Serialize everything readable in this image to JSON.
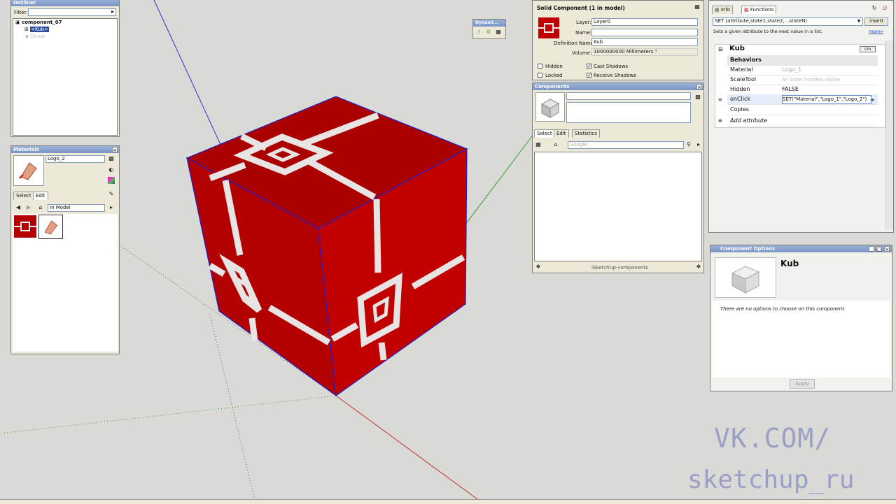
{
  "outliner": {
    "title": "Outliner",
    "filter_label": "Filter:",
    "tree": [
      "component_07",
      "<Kub>",
      "Group"
    ]
  },
  "materials": {
    "title": "Materials",
    "name_value": "Logo_2",
    "tabs": [
      "Select",
      "Edit"
    ],
    "collection": "In Model",
    "accent": "#b30000"
  },
  "dynamic_toolbar": {
    "title": "Dynami..."
  },
  "entity_info": {
    "title": "Solid Component (1 in model)",
    "layer_label": "Layer:",
    "layer_value": "Layer0",
    "name_label": "Name:",
    "name_value": "",
    "definition_label": "Definition Name:",
    "definition_value": "Kub",
    "volume_label": "Volume:",
    "volume_value": "1000000000 Millimeters ³",
    "hidden_label": "Hidden",
    "locked_label": "Locked",
    "cast_label": "Cast Shadows",
    "receive_label": "Receive Shadows"
  },
  "components": {
    "title": "Components",
    "tabs": [
      "Select",
      "Edit",
      "Statistics"
    ],
    "search_placeholder": "Google",
    "footer": "iSketchUp-components"
  },
  "attributes": {
    "tab_info": "Info",
    "tab_functions": "Functions",
    "function_value": "SET (attribute,state1,state2,...stateN)",
    "insert_label": "insert",
    "description": "Sets a given attribute to the next value in a list.",
    "more_label": "more»",
    "component_name": "Kub",
    "units_badge": "cm",
    "section": "Behaviors",
    "rows": [
      {
        "key": "Material",
        "value": "Logo_1"
      },
      {
        "key": "ScaleTool",
        "value": "All scale handles visible"
      },
      {
        "key": "Hidden",
        "value": "FALSE"
      },
      {
        "key": "onClick",
        "value": "SET(\"Material\",\"Logo_1\",\"Logo_2\")"
      },
      {
        "key": "Copies",
        "value": ""
      }
    ],
    "add_attribute": "Add attribute"
  },
  "component_options": {
    "title": "Component Options",
    "name": "Kub",
    "message": "There are no options to choose on this component.",
    "apply_label": "Apply"
  },
  "watermark": {
    "line1": "VK.COM/",
    "line2": "sketchup_ru"
  }
}
